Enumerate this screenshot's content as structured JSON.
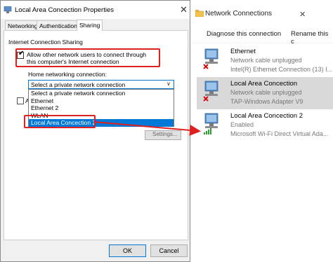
{
  "network_connections": {
    "title": "Network Connections",
    "close_glyph": "✕",
    "toolbar": {
      "diagnose": "Diagnose this connection",
      "rename": "Rename this c"
    },
    "connections": [
      {
        "name": "Ethernet",
        "status": "Network cable unplugged",
        "device": "Intel(R) Ethernet Connection (13) I...",
        "icon": "ethernet-disconnected-icon"
      },
      {
        "name": "Local Area Concection",
        "status": "Network cable unplugged",
        "device": "TAP-Windows Adapter V9",
        "icon": "ethernet-disconnected-icon",
        "selected": true
      },
      {
        "name": "Local Area Concection 2",
        "status": "Enabled",
        "device": "Microsoft Wi-Fi Direct Virtual Ada...",
        "icon": "wifi-enabled-icon"
      }
    ]
  },
  "dialog": {
    "title": "Local Area Concection Properties",
    "close_glyph": "✕",
    "tabs": [
      "Networking",
      "Authentication",
      "Sharing"
    ],
    "active_tab": "Sharing",
    "sharing": {
      "heading": "Internet Connection Sharing",
      "allow_label": "Allow other network users to connect through this computer's Internet connection",
      "allow_checked": true,
      "check_glyph": "✔",
      "home_label": "Home networking connection:",
      "select_value": "Select a private network connection",
      "select_arrow": "∨",
      "options": [
        "Select a private network connection",
        "Ethernet",
        "Ethernet 2",
        "WLAN",
        "Local Area Concection 2"
      ],
      "highlighted_option": "Local Area Concection 2",
      "hidden_checkbox_char": "A",
      "settings_peek": "Settings..."
    },
    "buttons": {
      "ok": "OK",
      "cancel": "Cancel"
    }
  },
  "colors": {
    "annotation": "#e02020",
    "selection": "#0078d7",
    "selected_row": "#d9d9d9"
  }
}
